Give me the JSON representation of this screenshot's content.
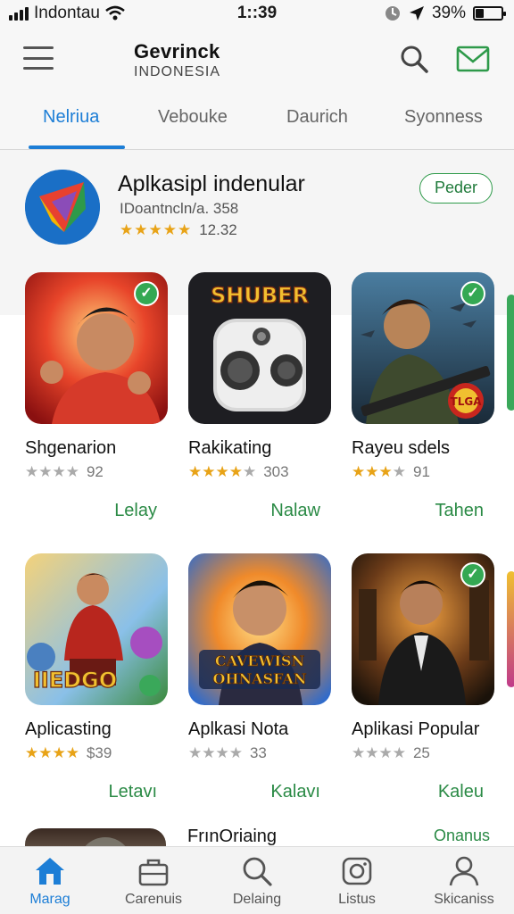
{
  "status_bar": {
    "carrier": "Indontau",
    "time": "1::39",
    "battery": "39%"
  },
  "header": {
    "title": "Gevrinck",
    "subtitle": "INDONESIA"
  },
  "tabs": [
    {
      "label": "Nelriua",
      "active": true
    },
    {
      "label": "Vebouke",
      "active": false
    },
    {
      "label": "Daurich",
      "active": false
    },
    {
      "label": "Syonness",
      "active": false
    }
  ],
  "featured": {
    "name": "Aplkasipl indenular",
    "developer": "IDoantncln/a. 358",
    "stars": "★★★★★",
    "rating": "12.32",
    "button": "Peder"
  },
  "apps": [
    {
      "name": "Shgenarion",
      "rating": "92",
      "stars_on": "",
      "stars_off": "★★★★",
      "action": "Lelay"
    },
    {
      "name": "Rakikating",
      "rating": "303",
      "stars_on": "★★★★",
      "stars_off": "★",
      "action": "Nalaw"
    },
    {
      "name": "Rayeu sdels",
      "rating": "91",
      "stars_on": "★★★",
      "stars_off": "★",
      "action": "Tahen"
    },
    {
      "name": "Aplicasting",
      "rating": "$39",
      "stars_on": "★★★★",
      "stars_off": "",
      "action": "Letavı"
    },
    {
      "name": "Aplkasi Nota",
      "rating": "33",
      "stars_on": "",
      "stars_off": "★★★★",
      "action": "Kalavı"
    },
    {
      "name": "Aplikasi Popular",
      "rating": "25",
      "stars_on": "",
      "stars_off": "★★★★",
      "action": "Kaleu"
    }
  ],
  "thumb_text": {
    "shuber": "SHUBER",
    "badge": "TLGA",
    "iedgo": "IIEDGO",
    "poster_line1": "CAVEWISN",
    "poster_line2": "OHNASFAN"
  },
  "partial": {
    "title": "FrınOriaing",
    "action": "Onanus"
  },
  "bottom_nav": [
    {
      "label": "Marag",
      "icon": "home-icon",
      "active": true
    },
    {
      "label": "Carenuis",
      "icon": "briefcase-icon",
      "active": false
    },
    {
      "label": "Delaing",
      "icon": "search-icon",
      "active": false
    },
    {
      "label": "Listus",
      "icon": "camera-icon",
      "active": false
    },
    {
      "label": "Skicaniss",
      "icon": "profile-icon",
      "active": false
    }
  ],
  "colors": {
    "accent_blue": "#1d7ed6",
    "action_green": "#2a8a45",
    "star_gold": "#e8a317"
  }
}
